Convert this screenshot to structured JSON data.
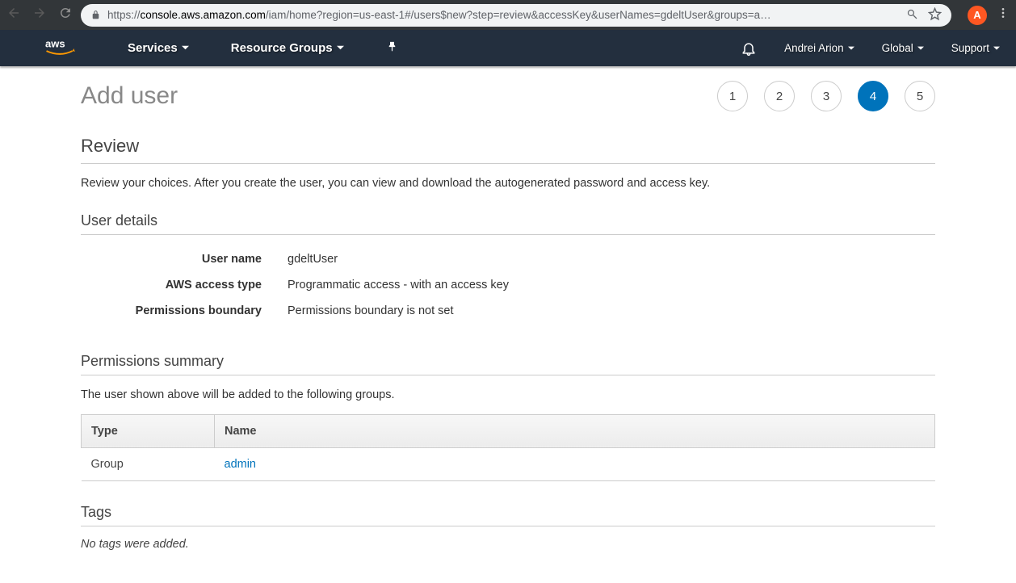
{
  "browser": {
    "url_prefix": "https://",
    "url_domain": "console.aws.amazon.com",
    "url_path": "/iam/home?region=us-east-1#/users$new?step=review&accessKey&userNames=gdeltUser&groups=a…",
    "avatar_letter": "A"
  },
  "nav": {
    "services": "Services",
    "resource_groups": "Resource Groups",
    "user": "Andrei Arion",
    "region": "Global",
    "support": "Support"
  },
  "page": {
    "title": "Add user",
    "steps": [
      "1",
      "2",
      "3",
      "4",
      "5"
    ],
    "active_step_index": 3
  },
  "review": {
    "heading": "Review",
    "text": "Review your choices. After you create the user, you can view and download the autogenerated password and access key."
  },
  "user_details": {
    "heading": "User details",
    "rows": [
      {
        "label": "User name",
        "value": "gdeltUser"
      },
      {
        "label": "AWS access type",
        "value": "Programmatic access - with an access key"
      },
      {
        "label": "Permissions boundary",
        "value": "Permissions boundary is not set"
      }
    ]
  },
  "permissions": {
    "heading": "Permissions summary",
    "text": "The user shown above will be added to the following groups.",
    "columns": {
      "type": "Type",
      "name": "Name"
    },
    "rows": [
      {
        "type": "Group",
        "name": "admin"
      }
    ]
  },
  "tags": {
    "heading": "Tags",
    "empty": "No tags were added."
  }
}
